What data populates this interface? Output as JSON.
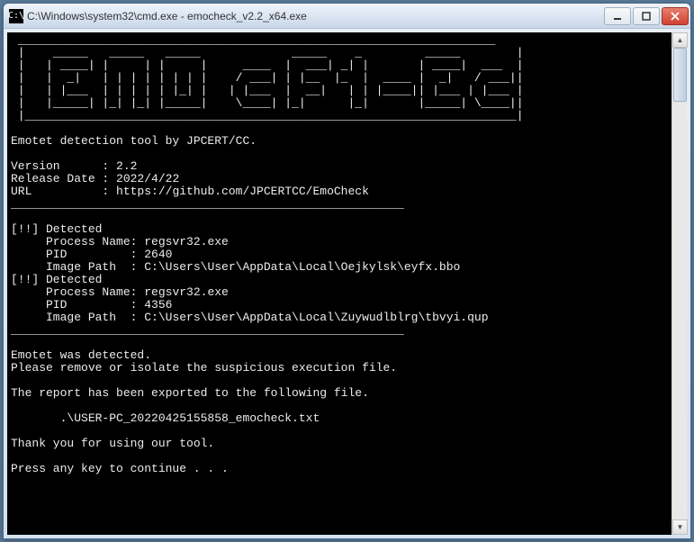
{
  "window": {
    "title": "C:\\Windows\\system32\\cmd.exe - emocheck_v2.2_x64.exe",
    "icon_glyph": "C:\\"
  },
  "terminal": {
    "ascii_art": " ____________________________________________________________________\n |    _____   _____   _____             _____    _         _____        |\n |   | ____| |     | |     |     ____  |  ___| _| |       | ____|  ___  |\n |   |  _|   | | | | | | | |    / ___| | |__  |_  |  ____ |  _|   / ___||\n |   | |___  | | | | | |_| |   | |___  |  __|   | | |____|| |___ | |___ |\n |   |_____| |_| |_| |_____|    \\____| |_|      |_|       |_____| \\____||\n |______________________________________________________________________|",
    "divider": "________________________________________________________",
    "tool_desc": "Emotet detection tool by JPCERT/CC.",
    "version_label": "Version      : ",
    "version_value": "2.2",
    "release_label": "Release Date : ",
    "release_value": "2022/4/22",
    "url_label": "URL          : ",
    "url_value": "https://github.com/JPCERTCC/EmoCheck",
    "detected_label": "[!!] Detected",
    "proc_label": "     Process Name: ",
    "pid_label": "     PID         : ",
    "img_label": "     Image Path  : ",
    "detections": [
      {
        "process": "regsvr32.exe",
        "pid": "2640",
        "path": "C:\\Users\\User\\AppData\\Local\\Oejkylsk\\eyfx.bbo"
      },
      {
        "process": "regsvr32.exe",
        "pid": "4356",
        "path": "C:\\Users\\User\\AppData\\Local\\Zuywudlblrg\\tbvyi.qup"
      }
    ],
    "result1": "Emotet was detected.",
    "result2": "Please remove or isolate the suspicious execution file.",
    "export_msg": "The report has been exported to the following file.",
    "export_file": "       .\\USER-PC_20220425155858_emocheck.txt",
    "thanks": "Thank you for using our tool.",
    "prompt": "Press any key to continue . . ."
  }
}
